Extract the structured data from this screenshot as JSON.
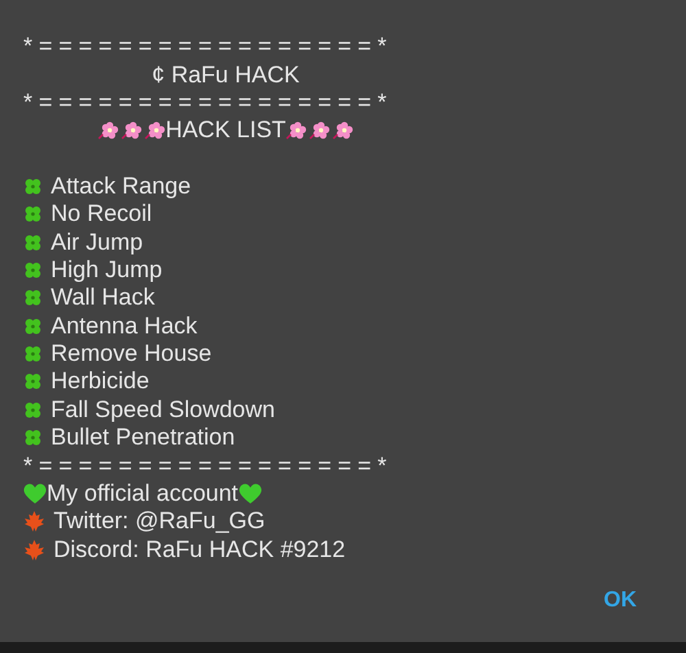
{
  "dialog": {
    "lines": [
      {
        "kind": "separator",
        "text": "*=================*"
      },
      {
        "kind": "title",
        "text": "¢ RaFu HACK"
      },
      {
        "kind": "separator",
        "text": "*=================*"
      },
      {
        "kind": "list-header",
        "text": "HACK LIST"
      },
      {
        "kind": "item",
        "text": "Attack Range"
      },
      {
        "kind": "item",
        "text": "No Recoil"
      },
      {
        "kind": "item",
        "text": "Air Jump"
      },
      {
        "kind": "item",
        "text": "High Jump"
      },
      {
        "kind": "item",
        "text": "Wall Hack"
      },
      {
        "kind": "item",
        "text": "Antenna Hack"
      },
      {
        "kind": "item",
        "text": "Remove House"
      },
      {
        "kind": "item",
        "text": "Herbicide"
      },
      {
        "kind": "item",
        "text": "Fall Speed Slowdown"
      },
      {
        "kind": "item",
        "text": "Bullet Penetration"
      },
      {
        "kind": "separator",
        "text": "*=================*"
      },
      {
        "kind": "account-header",
        "text": "My official account"
      },
      {
        "kind": "link",
        "text": "Twitter: @RaFu_GG"
      },
      {
        "kind": "link",
        "text": "Discord: RaFu HACK #9212"
      }
    ],
    "buttons": [
      "OK"
    ]
  }
}
